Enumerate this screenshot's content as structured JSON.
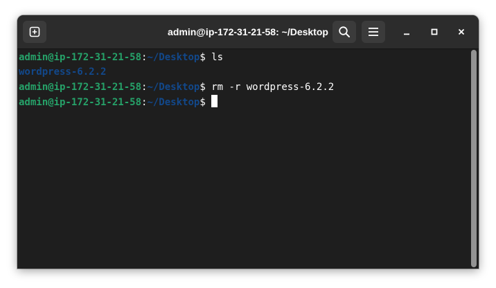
{
  "window": {
    "title": "admin@ip-172-31-21-58: ~/Desktop"
  },
  "header": {
    "new_tab_icon": "new-tab-icon",
    "search_icon": "search-icon",
    "menu_icon": "hamburger-menu-icon",
    "minimize_icon": "minimize-icon",
    "maximize_icon": "maximize-icon",
    "close_icon": "close-icon"
  },
  "terminal": {
    "lines": [
      {
        "user": "admin@ip-172-31-21-58",
        "colon": ":",
        "path": "~/Desktop",
        "dollar": "$ ",
        "command": "ls"
      },
      {
        "output": "wordpress-6.2.2"
      },
      {
        "user": "admin@ip-172-31-21-58",
        "colon": ":",
        "path": "~/Desktop",
        "dollar": "$ ",
        "command": "rm -r wordpress-6.2.2"
      },
      {
        "user": "admin@ip-172-31-21-58",
        "colon": ":",
        "path": "~/Desktop",
        "dollar": "$ ",
        "command": ""
      }
    ]
  },
  "colors": {
    "user": "#26a269",
    "path": "#12488b",
    "background": "#1e1e1e",
    "titlebar": "#2c2c2c"
  }
}
